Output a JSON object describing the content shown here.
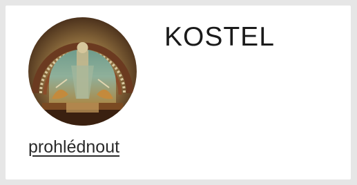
{
  "card": {
    "title": "KOSTEL",
    "link_label": "prohlédnout",
    "image": "church-stained-glass-window-photo"
  },
  "colors": {
    "page_background": "#e6e6e6",
    "card_background": "#ffffff",
    "text": "#1a1a1a"
  }
}
